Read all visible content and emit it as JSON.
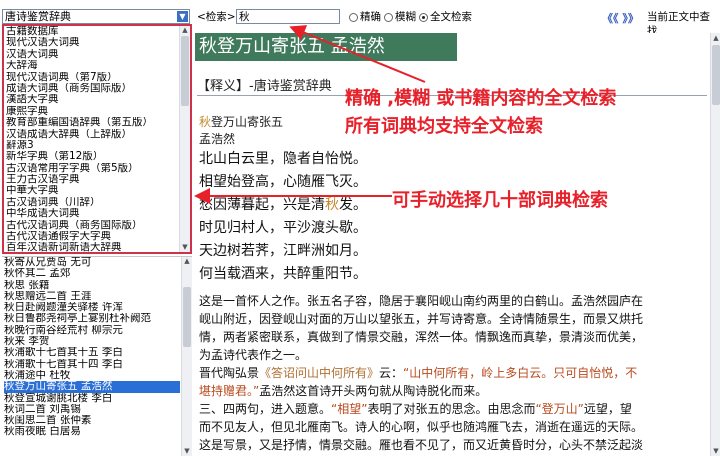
{
  "dict_select": {
    "value": "唐诗鉴赏辞典"
  },
  "dict_list": [
    "古籍数据库",
    "现代汉语大词典",
    "汉语大词典",
    "大辞海",
    "现代汉语词典（第7版）",
    "成语大词典（商务国际版）",
    "漢語大字典",
    "康熙字典",
    "教育部重编国语辞典（第五版）",
    "汉语成语大辞典（上辞版）",
    "辭源3",
    "新华字典（第12版）",
    "古汉语常用字字典（第5版）",
    "王力古汉语字典",
    "中華大字典",
    "古汉语词典（川辞）",
    "中华成语大词典",
    "古代汉语词典（商务国际版）",
    "古代汉语通假字大字典",
    "百年汉语新词新语大辞典"
  ],
  "poem_list": [
    "秋寄从兄贾岛  无可",
    "秋怀其二  孟郊",
    "秋思  张籍",
    "秋思赠远二首  王涯",
    "秋日赴阙题潼关驿楼  许浑",
    "秋日鲁郡尧祠亭上宴别杜补阙范",
    "秋晚行南谷经荒村  柳宗元",
    "秋来  李贺",
    "秋浦歌十七首其十五  李白",
    "秋浦歌十七首其十四  李白",
    "秋浦途中  杜牧",
    "秋登万山寄张五  孟浩然",
    "秋登宣城谢朓北楼  李白",
    "秋词二首  刘禹锡",
    "秋闺思二首  张仲素",
    "秋雨夜眠  白居易"
  ],
  "selected_poem_index": 11,
  "toolbar": {
    "search_label": "<检索>",
    "search_value": "秋",
    "radio_exact": "精确",
    "radio_fuzzy": "模糊",
    "radio_fulltext": "全文检索",
    "nav_arrows": "《《 》》",
    "find_in_current": "当前正文中查找"
  },
  "content": {
    "title": "秋登万山寄张五  孟浩然",
    "shiyi": "【释义】-唐诗鉴赏辞典",
    "poem_name_hl": "秋",
    "poem_name_rest": "登万山寄张五",
    "author": "孟浩然",
    "verses": [
      {
        "pre": "北山白云里，隐者自怡悦。",
        "hl": "",
        "post": ""
      },
      {
        "pre": "相望始登高，心随雁飞灭。",
        "hl": "",
        "post": ""
      },
      {
        "pre": "愁因薄暮起，兴是清",
        "hl": "秋",
        "post": "发。"
      },
      {
        "pre": "时见归村人，平沙渡头歇。",
        "hl": "",
        "post": ""
      },
      {
        "pre": "天边树若荠，江畔洲如月。",
        "hl": "",
        "post": ""
      },
      {
        "pre": "何当载酒来，共醉重阳节。",
        "hl": "",
        "post": ""
      }
    ],
    "para1": "这是一首怀人之作。张五名子容，隐居于襄阳岘山南约两里的白鹤山。孟浩然园庐在",
    "para2": "岘山附近，因登岘山对面的万山以望张五，并写诗寄意。全诗情随景生，而景又烘托",
    "para3": "情，两者紧密联系，真做到了情景交融，浑然一体。情飘逸而真挚，景清淡而优美，",
    "para4": "为孟诗代表作之一。",
    "para5_a": "晋代陶弘景",
    "para5_src": "《答诏问山中何所有》",
    "para5_b": "云：",
    "para5_quote": "“山中何所有，岭上多白云。只可自怡悦，不",
    "para6_quote": "堪持赠君。”",
    "para6_b": "孟浩然这首诗开头两句就从陶诗脱化而来。",
    "para7_a": "三、四两句，进入题意。",
    "para7_q1": "“相望”",
    "para7_b": "表明了对张五的思念。由思念而",
    "para7_q2": "“登万山”",
    "para7_c": "远望，望",
    "para8": "而不见友人，但见北雁南飞。诗人的心啊，似乎也随鸿雁飞去，消逝在遥远的天际。",
    "para9": "这是写景，又是抒情，情景交融。雁也看不见了，而又近黄昏时分，心头不禁泛起淡"
  },
  "annotations": {
    "line1": "精确 ,模糊 或书籍内容的全文检索",
    "line2": "所有词典均支持全文检索",
    "line3": "可手动选择几十部词典检索"
  },
  "colors": {
    "title_bg": "#3f7a5c",
    "annotation": "#e8202a",
    "selection": "#2a6fd6",
    "highlight": "#c08a2a"
  }
}
